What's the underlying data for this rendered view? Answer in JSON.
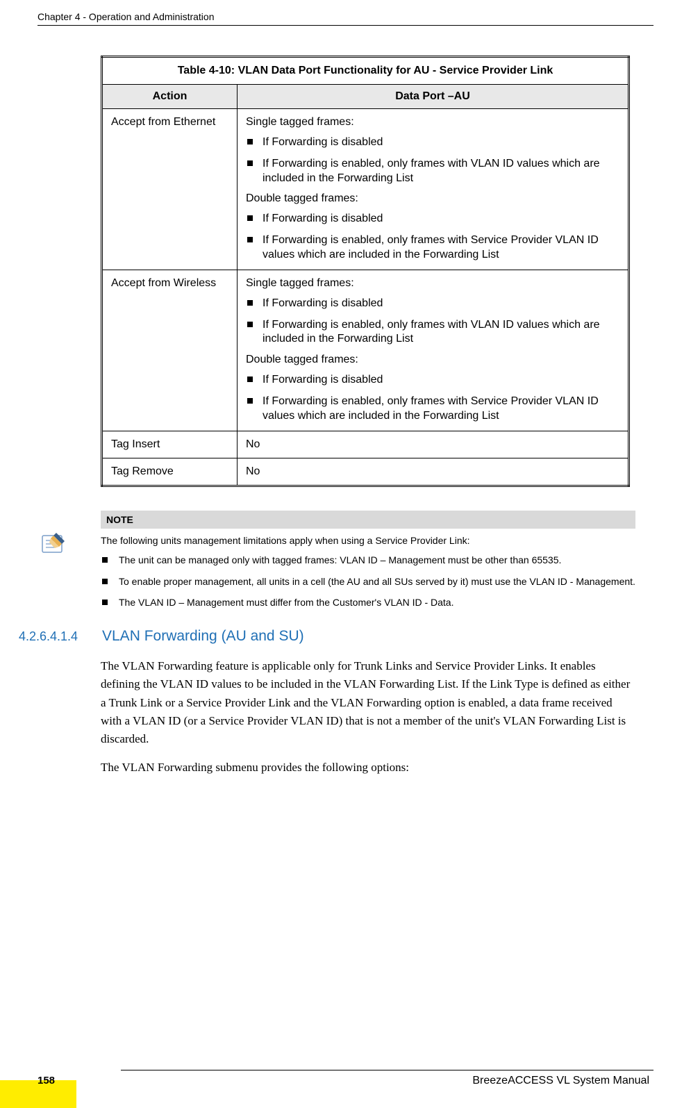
{
  "header": {
    "chapter": "Chapter 4 - Operation and Administration"
  },
  "table": {
    "title": "Table 4-10: VLAN Data Port Functionality for AU - Service Provider Link",
    "col1": "Action",
    "col2": "Data Port –AU",
    "rows": {
      "r1": {
        "action": "Accept from Ethernet",
        "lead1": "Single tagged frames:",
        "b1": "If Forwarding is disabled",
        "b2": "If Forwarding is enabled, only frames with VLAN ID values which are included in the Forwarding List",
        "lead2": "Double tagged frames:",
        "b3": "If Forwarding is disabled",
        "b4": "If Forwarding is enabled, only frames with Service Provider VLAN ID values which are included in the Forwarding List"
      },
      "r2": {
        "action": "Accept from Wireless",
        "lead1": "Single tagged frames:",
        "b1": "If Forwarding is disabled",
        "b2": "If Forwarding is enabled, only frames with VLAN ID values which are included in the Forwarding List",
        "lead2": "Double tagged frames:",
        "b3": "If Forwarding is disabled",
        "b4": "If Forwarding is enabled, only frames with Service Provider VLAN ID values which are included in the Forwarding List"
      },
      "r3": {
        "action": "Tag Insert",
        "val": "No"
      },
      "r4": {
        "action": "Tag Remove",
        "val": "No"
      }
    }
  },
  "note": {
    "label": "NOTE",
    "intro": "The following units management limitations apply when using a Service Provider Link:",
    "b1": "The unit can be managed only with tagged frames: VLAN ID – Management must be other than 65535.",
    "b2": "To enable proper management, all units in a cell (the AU and all SUs served by it) must use the VLAN ID - Management.",
    "b3": "The VLAN ID – Management must differ from the Customer's VLAN ID - Data."
  },
  "section": {
    "num": "4.2.6.4.1.4",
    "title": "VLAN Forwarding (AU and SU)",
    "p1": "The VLAN Forwarding feature is applicable only for Trunk Links and Service Provider Links. It enables defining the VLAN ID values to be included in the VLAN Forwarding List. If the Link Type is defined as either a Trunk Link or a Service Provider Link and the VLAN Forwarding option is enabled, a data frame received with a VLAN ID (or a Service Provider VLAN ID) that is not a member of the unit's VLAN Forwarding List is discarded.",
    "p2": "The VLAN Forwarding submenu provides the following options:"
  },
  "footer": {
    "manual": "BreezeACCESS VL System Manual",
    "page": "158"
  }
}
